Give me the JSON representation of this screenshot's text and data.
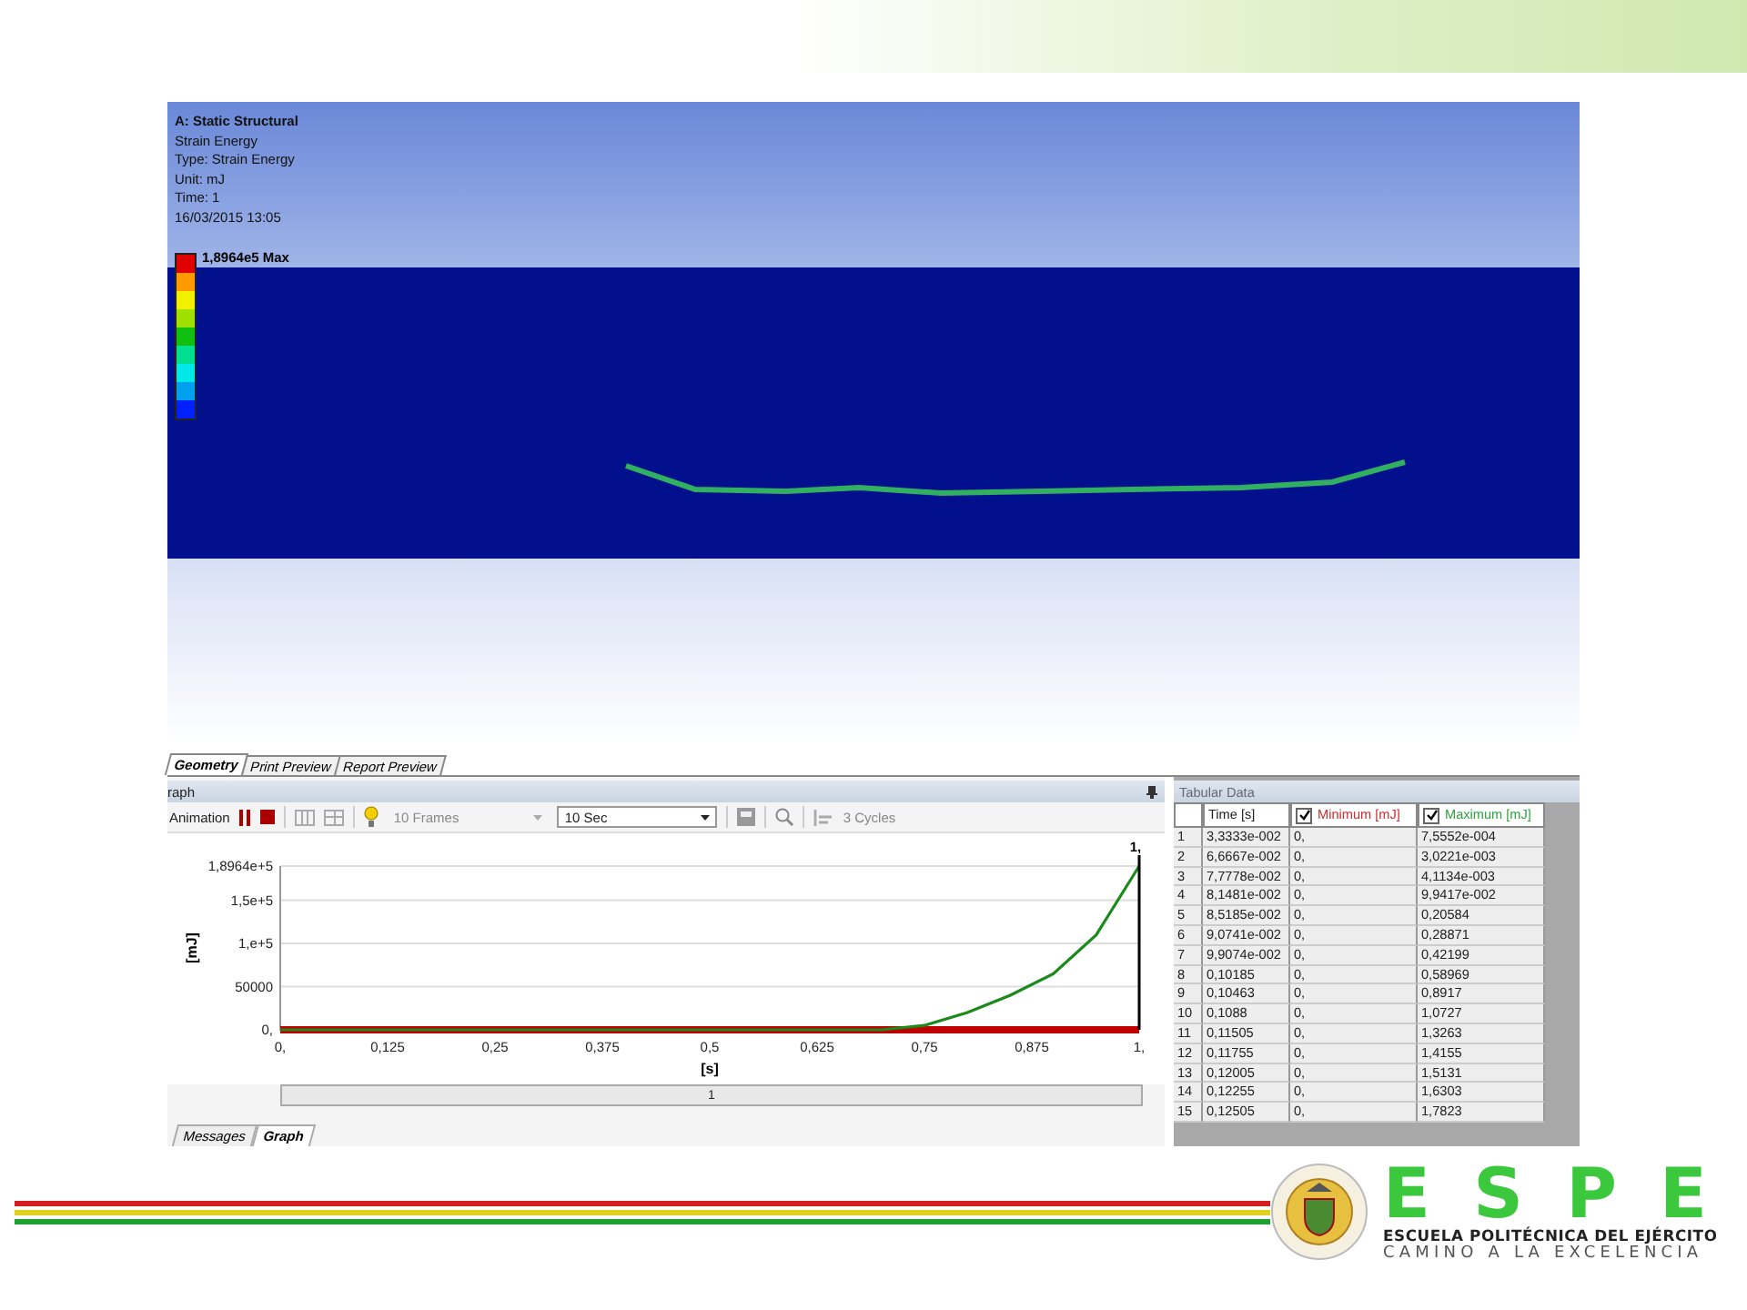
{
  "viewport": {
    "title": "A: Static Structural",
    "info": [
      "Strain Energy",
      "Type: Strain Energy",
      "Unit: mJ",
      "Time: 1",
      "16/03/2015 13:05"
    ],
    "legend_max": "1,8964e5 Max",
    "legend_colors": [
      {
        "color": "#e00000"
      },
      {
        "color": "#ff9900"
      },
      {
        "color": "#f0f000"
      },
      {
        "color": "#a0e000"
      },
      {
        "color": "#10c010"
      },
      {
        "color": "#00e090"
      },
      {
        "color": "#00e8e8"
      },
      {
        "color": "#00a0f0"
      },
      {
        "color": "#0020ff"
      }
    ]
  },
  "tabs": [
    {
      "label": "Geometry",
      "selected": true
    },
    {
      "label": "Print Preview",
      "selected": false
    },
    {
      "label": "Report Preview",
      "selected": false
    }
  ],
  "graph": {
    "title": "raph",
    "animation_label": "Animation",
    "frames": "10 Frames",
    "duration": "10 Sec",
    "cycles": "3 Cycles",
    "scrubber": "1",
    "chart_data": {
      "type": "line",
      "xlabel": "[s]",
      "ylabel": "[mJ]",
      "xlim": [
        0,
        1
      ],
      "ylim": [
        0,
        189640
      ],
      "grid": true,
      "xticks": [
        {
          "value": 0,
          "label": "0,"
        },
        {
          "value": 0.125,
          "label": "0,125"
        },
        {
          "value": 0.25,
          "label": "0,25"
        },
        {
          "value": 0.375,
          "label": "0,375"
        },
        {
          "value": 0.5,
          "label": "0,5"
        },
        {
          "value": 0.625,
          "label": "0,625"
        },
        {
          "value": 0.75,
          "label": "0,75"
        },
        {
          "value": 0.875,
          "label": "0,875"
        },
        {
          "value": 1,
          "label": "1,"
        }
      ],
      "yticks": [
        {
          "value": 0,
          "label": "0,"
        },
        {
          "value": 50000,
          "label": "50000"
        },
        {
          "value": 100000,
          "label": "1,e+5"
        },
        {
          "value": 150000,
          "label": "1,5e+5"
        },
        {
          "value": 189640,
          "label": "1,8964e+5"
        }
      ],
      "x": [
        0,
        0.625,
        0.7,
        0.75,
        0.8,
        0.85,
        0.9,
        0.95,
        1
      ],
      "series": [
        {
          "color": "#c00000",
          "values": [
            0,
            0,
            0,
            0,
            0,
            0,
            0,
            0,
            0
          ]
        },
        {
          "color": "#1a8a1a",
          "values": [
            0,
            0,
            0,
            5000,
            20000,
            40000,
            65000,
            110000,
            189640
          ]
        }
      ],
      "annotations": [
        "1,"
      ]
    }
  },
  "bottom_tabs": [
    {
      "label": "Messages",
      "selected": false
    },
    {
      "label": "Graph",
      "selected": true
    }
  ],
  "tabular": {
    "title": "Tabular Data",
    "columns": [
      {},
      {
        "label": "Time [s]"
      },
      {
        "label": "Minimum [mJ]",
        "checked": true,
        "color": "#c03030"
      },
      {
        "label": "Maximum [mJ]",
        "checked": true,
        "color": "#30a040"
      }
    ],
    "rows": [
      [
        "1",
        "3,3333e-002",
        "0,",
        "7,5552e-004"
      ],
      [
        "2",
        "6,6667e-002",
        "0,",
        "3,0221e-003"
      ],
      [
        "3",
        "7,7778e-002",
        "0,",
        "4,1134e-003"
      ],
      [
        "4",
        "8,1481e-002",
        "0,",
        "9,9417e-002"
      ],
      [
        "5",
        "8,5185e-002",
        "0,",
        "0,20584"
      ],
      [
        "6",
        "9,0741e-002",
        "0,",
        "0,28871"
      ],
      [
        "7",
        "9,9074e-002",
        "0,",
        "0,42199"
      ],
      [
        "8",
        "0,10185",
        "0,",
        "0,58969"
      ],
      [
        "9",
        "0,10463",
        "0,",
        "0,8917"
      ],
      [
        "10",
        "0,1088",
        "0,",
        "1,0727"
      ],
      [
        "11",
        "0,11505",
        "0,",
        "1,3263"
      ],
      [
        "12",
        "0,11755",
        "0,",
        "1,4155"
      ],
      [
        "13",
        "0,12005",
        "0,",
        "1,5131"
      ],
      [
        "14",
        "0,12255",
        "0,",
        "1,6303"
      ],
      [
        "15",
        "0,12505",
        "0,",
        "1,7823"
      ]
    ]
  },
  "logo": {
    "letters": [
      "E",
      "S",
      "P",
      "E"
    ],
    "name": "ESCUELA POLITÉCNICA DEL EJÉRCITO",
    "motto": "CAMINO A LA EXCELENCIA"
  }
}
